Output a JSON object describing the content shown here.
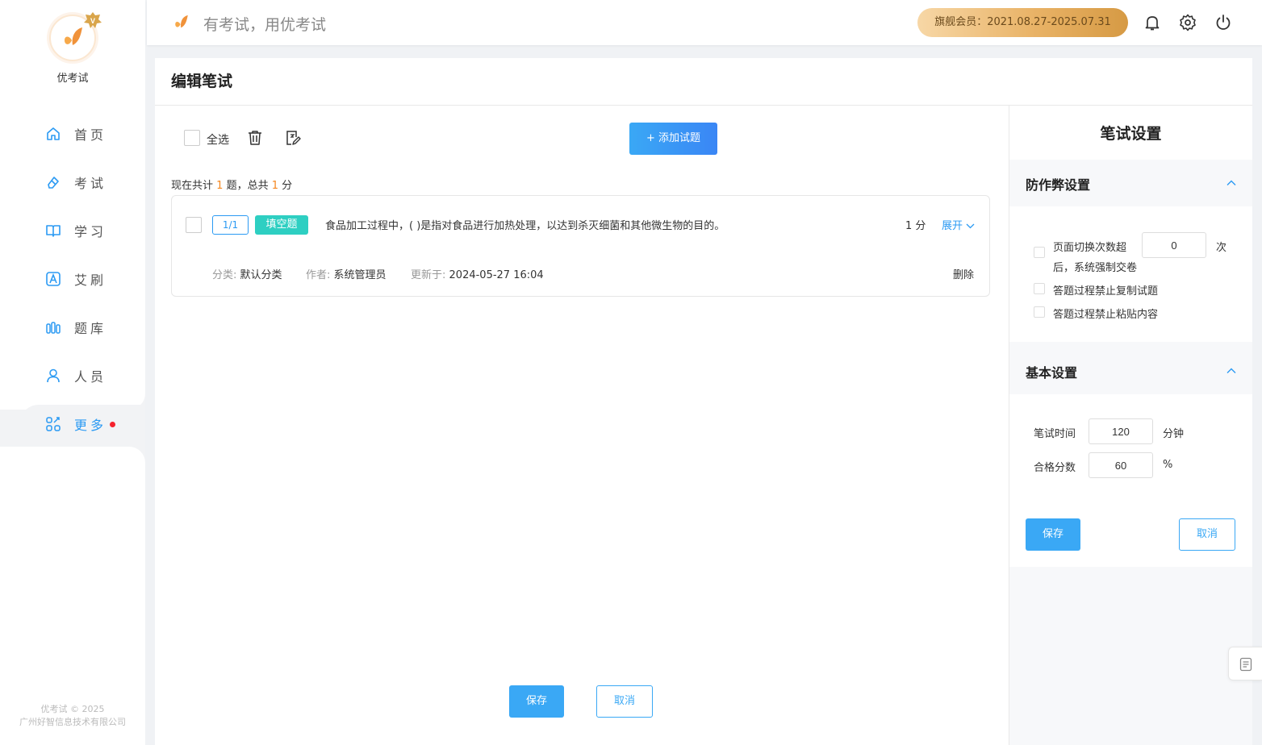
{
  "app": {
    "name": "优考试",
    "copyright_line1": "优考试 © 2025",
    "copyright_line2": "广州好智信息技术有限公司"
  },
  "sidebar": {
    "items": [
      {
        "label": "首页",
        "icon": "home-icon"
      },
      {
        "label": "考试",
        "icon": "eraser-icon"
      },
      {
        "label": "学习",
        "icon": "book-icon"
      },
      {
        "label": "艾刷",
        "icon": "letter-a-icon"
      },
      {
        "label": "题库",
        "icon": "library-icon"
      },
      {
        "label": "人员",
        "icon": "user-icon"
      },
      {
        "label": "更多",
        "icon": "apps-icon",
        "active": true,
        "has_dot": true
      }
    ]
  },
  "header": {
    "slogan": "有考试，用优考试",
    "membership": "旗舰会员：2021.08.27-2025.07.31"
  },
  "page": {
    "title": "编辑笔试",
    "select_all": "全选",
    "add_question": "+ 添加试题",
    "summary_prefix": "现在共计",
    "summary_count": "1",
    "summary_mid": "题，总共",
    "summary_score": "1",
    "summary_suffix": "分",
    "save": "保存",
    "cancel": "取消"
  },
  "question": {
    "index": "1/1",
    "type": "填空题",
    "text": "食品加工过程中，(    )是指对食品进行加热处理，以达到杀灭细菌和其他微生物的目的。",
    "score": "1 分",
    "expand": "展开",
    "category_key": "分类:",
    "category_val": "默认分类",
    "author_key": "作者:",
    "author_val": "系统管理员",
    "updated_key": "更新于:",
    "updated_val": "2024-05-27 16:04",
    "delete": "删除"
  },
  "settings": {
    "title": "笔试设置",
    "anticheat": {
      "title": "防作弊设置",
      "switch_text_a": "页面切换次数超",
      "switch_value": "0",
      "switch_text_b": "次",
      "switch_text_c": "后，系统强制交卷",
      "no_copy": "答题过程禁止复制试题",
      "no_paste": "答题过程禁止粘贴内容"
    },
    "basic": {
      "title": "基本设置",
      "time_label": "笔试时间",
      "time_value": "120",
      "time_unit": "分钟",
      "pass_label": "合格分数",
      "pass_value": "60",
      "pass_unit": "%"
    },
    "save": "保存",
    "cancel": "取消"
  },
  "colors": {
    "accent": "#2b9af3",
    "tag_green": "#2ecfc2",
    "orange": "#f5871f",
    "gold": "#e9b367"
  }
}
